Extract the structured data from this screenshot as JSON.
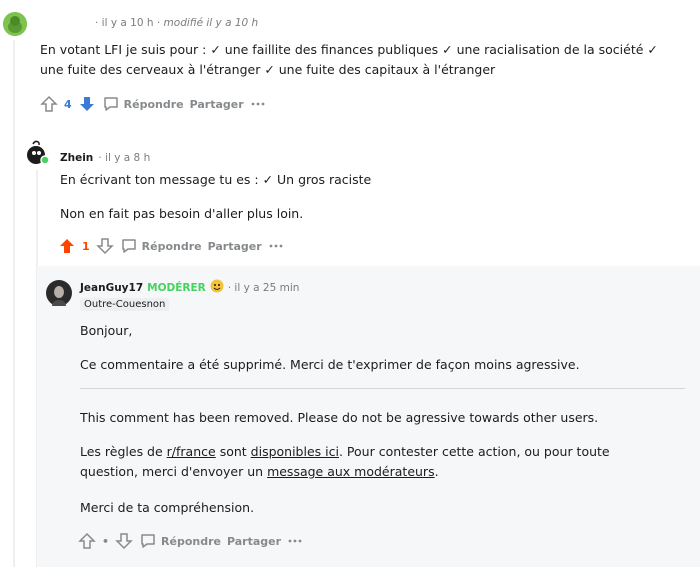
{
  "comment1": {
    "meta": "· il y a 10 h · ",
    "edited": "modifié il y a 10 h",
    "body": "En votant LFI je suis pour : ✓ une faillite des finances publiques ✓ une racialisation de la société ✓ une fuite des cerveaux à l'étranger ✓ une fuite des capitaux à l'étranger",
    "score": "4",
    "reply": "Répondre",
    "share": "Partager"
  },
  "comment2": {
    "author": "Zhein",
    "meta": "· il y a 8 h",
    "line1": "En écrivant ton message tu es : ✓ Un gros raciste",
    "line2": "Non en fait pas besoin d'aller plus loin.",
    "score": "1",
    "reply": "Répondre",
    "share": "Partager"
  },
  "comment3": {
    "author": "JeanGuy17",
    "mod_label": "MODÉRER",
    "meta": "· il y a 25 min",
    "flair": "Outre-Couesnon",
    "greeting": "Bonjour,",
    "removed_fr": "Ce commentaire a été supprimé. Merci de t'exprimer de façon moins agressive.",
    "removed_en": "This comment has been removed. Please do not be agressive towards other users.",
    "rules_pre": "Les règles de ",
    "rules_link": "r/france",
    "rules_mid": " sont ",
    "rules_link2": "disponibles ici",
    "rules_post": ". Pour contester cette action, ou pour toute",
    "rules_line2_pre": "question, merci d'envoyer un ",
    "rules_link3": "message aux modérateurs",
    "rules_line2_post": ".",
    "thanks": "Merci de ta compréhension.",
    "score": "•",
    "reply": "Répondre",
    "share": "Partager"
  },
  "colors": {
    "upvote_blue": "#3a7bd5",
    "downvote_blue": "#3a7bd5",
    "upvote_red": "#ff4500",
    "moderator_green": "#46d160"
  },
  "icons": [
    "upvote-icon",
    "downvote-icon",
    "comment-icon",
    "more-icon",
    "moderator-shield-icon"
  ]
}
